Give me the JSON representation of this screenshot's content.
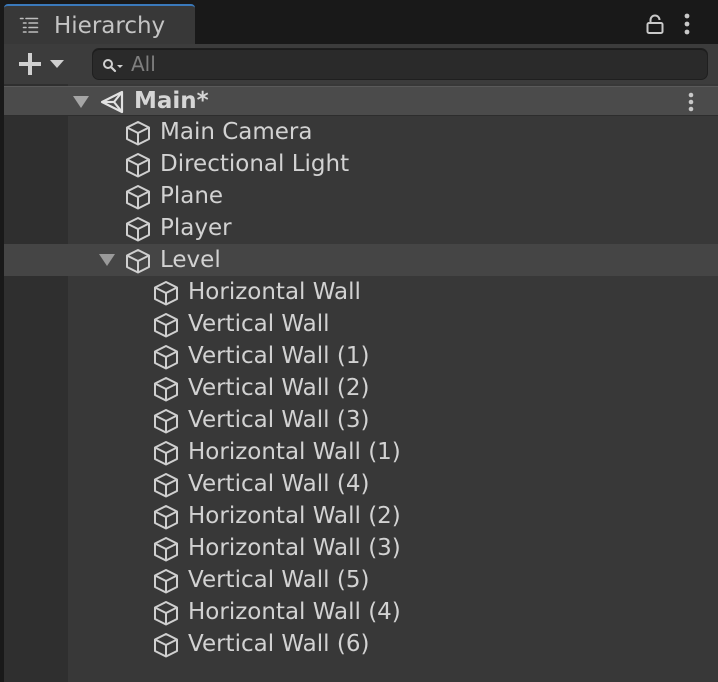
{
  "window": {
    "tab_title": "Hierarchy",
    "tab_icon": "hierarchy-list-icon",
    "lock_icon": "lock-icon",
    "menu_icon": "kebab-menu-icon"
  },
  "toolbar": {
    "create_icon": "plus-icon",
    "create_dropdown_icon": "caret-down-icon",
    "search": {
      "placeholder": "All",
      "value": "",
      "icon": "search-icon"
    }
  },
  "scene": {
    "name": "Main*",
    "icon": "unity-scene-icon",
    "expanded": true,
    "objects": [
      {
        "name": "Main Camera",
        "icon": "gameobject-cube-icon"
      },
      {
        "name": "Directional Light",
        "icon": "gameobject-cube-icon"
      },
      {
        "name": "Plane",
        "icon": "gameobject-cube-icon"
      },
      {
        "name": "Player",
        "icon": "gameobject-cube-icon"
      },
      {
        "name": "Level",
        "icon": "gameobject-cube-icon",
        "expanded": true,
        "children": [
          {
            "name": "Horizontal Wall",
            "icon": "gameobject-cube-icon"
          },
          {
            "name": "Vertical Wall",
            "icon": "gameobject-cube-icon"
          },
          {
            "name": "Vertical Wall (1)",
            "icon": "gameobject-cube-icon"
          },
          {
            "name": "Vertical Wall (2)",
            "icon": "gameobject-cube-icon"
          },
          {
            "name": "Vertical Wall (3)",
            "icon": "gameobject-cube-icon"
          },
          {
            "name": "Horizontal Wall (1)",
            "icon": "gameobject-cube-icon"
          },
          {
            "name": "Vertical Wall (4)",
            "icon": "gameobject-cube-icon"
          },
          {
            "name": "Horizontal Wall (2)",
            "icon": "gameobject-cube-icon"
          },
          {
            "name": "Horizontal Wall (3)",
            "icon": "gameobject-cube-icon"
          },
          {
            "name": "Vertical Wall (5)",
            "icon": "gameobject-cube-icon"
          },
          {
            "name": "Horizontal Wall (4)",
            "icon": "gameobject-cube-icon"
          },
          {
            "name": "Vertical Wall (6)",
            "icon": "gameobject-cube-icon"
          }
        ]
      }
    ]
  },
  "colors": {
    "accent": "#3a79bb",
    "panel": "#383838",
    "text": "#d2d2d2"
  }
}
